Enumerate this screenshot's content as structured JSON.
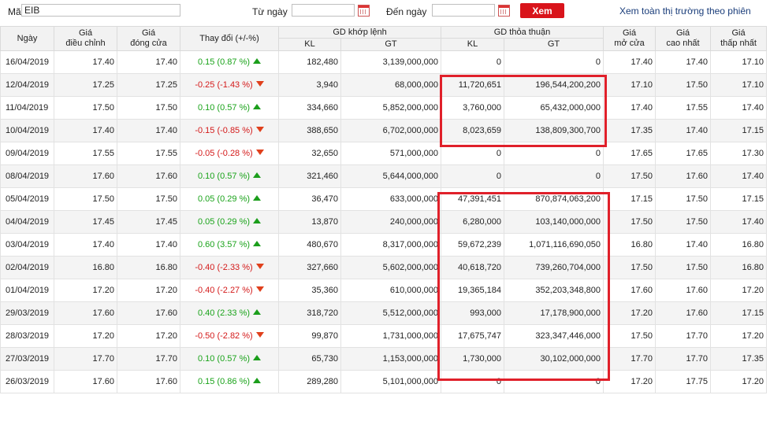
{
  "filter": {
    "ma_label": "Mã",
    "ma_value": "EIB",
    "from_label": "Từ ngày",
    "from_value": "",
    "to_label": "Đến ngày",
    "to_value": "",
    "button": "Xem",
    "market_link": "Xem toàn thị trường theo phiên",
    "calendar_icon": "calendar-icon"
  },
  "headers": {
    "date": "Ngày",
    "adjusted": "Giá\nđiều chỉnh",
    "close": "Giá\nđóng cửa",
    "change": "Thay đổi (+/-%)",
    "matched": "GD khớp lệnh",
    "negotiated": "GD thỏa thuận",
    "kl": "KL",
    "gt": "GT",
    "open": "Giá\nmở cửa",
    "high": "Giá\ncao nhất",
    "low": "Giá\nthấp nhất"
  },
  "colors": {
    "up": "#1aa31a",
    "down": "#d41a1a",
    "button": "#d9141b",
    "highlight": "#e0202a",
    "link": "#1a3d7a"
  },
  "rows": [
    {
      "date": "16/04/2019",
      "adj": "17.40",
      "close": "17.40",
      "change": "0.15 (0.87 %)",
      "dir": "up",
      "kl": "182,480",
      "gt": "3,139,000,000",
      "tt_kl": "0",
      "tt_gt": "0",
      "open": "17.40",
      "high": "17.40",
      "low": "17.10"
    },
    {
      "date": "12/04/2019",
      "adj": "17.25",
      "close": "17.25",
      "change": "-0.25 (-1.43 %)",
      "dir": "down",
      "kl": "3,940",
      "gt": "68,000,000",
      "tt_kl": "11,720,651",
      "tt_gt": "196,544,200,200",
      "open": "17.10",
      "high": "17.50",
      "low": "17.10"
    },
    {
      "date": "11/04/2019",
      "adj": "17.50",
      "close": "17.50",
      "change": "0.10 (0.57 %)",
      "dir": "up",
      "kl": "334,660",
      "gt": "5,852,000,000",
      "tt_kl": "3,760,000",
      "tt_gt": "65,432,000,000",
      "open": "17.40",
      "high": "17.55",
      "low": "17.40"
    },
    {
      "date": "10/04/2019",
      "adj": "17.40",
      "close": "17.40",
      "change": "-0.15 (-0.85 %)",
      "dir": "down",
      "kl": "388,650",
      "gt": "6,702,000,000",
      "tt_kl": "8,023,659",
      "tt_gt": "138,809,300,700",
      "open": "17.35",
      "high": "17.40",
      "low": "17.15"
    },
    {
      "date": "09/04/2019",
      "adj": "17.55",
      "close": "17.55",
      "change": "-0.05 (-0.28 %)",
      "dir": "down",
      "kl": "32,650",
      "gt": "571,000,000",
      "tt_kl": "0",
      "tt_gt": "0",
      "open": "17.65",
      "high": "17.65",
      "low": "17.30"
    },
    {
      "date": "08/04/2019",
      "adj": "17.60",
      "close": "17.60",
      "change": "0.10 (0.57 %)",
      "dir": "up",
      "kl": "321,460",
      "gt": "5,644,000,000",
      "tt_kl": "0",
      "tt_gt": "0",
      "open": "17.50",
      "high": "17.60",
      "low": "17.40"
    },
    {
      "date": "05/04/2019",
      "adj": "17.50",
      "close": "17.50",
      "change": "0.05 (0.29 %)",
      "dir": "up",
      "kl": "36,470",
      "gt": "633,000,000",
      "tt_kl": "47,391,451",
      "tt_gt": "870,874,063,200",
      "open": "17.15",
      "high": "17.50",
      "low": "17.15"
    },
    {
      "date": "04/04/2019",
      "adj": "17.45",
      "close": "17.45",
      "change": "0.05 (0.29 %)",
      "dir": "up",
      "kl": "13,870",
      "gt": "240,000,000",
      "tt_kl": "6,280,000",
      "tt_gt": "103,140,000,000",
      "open": "17.50",
      "high": "17.50",
      "low": "17.40"
    },
    {
      "date": "03/04/2019",
      "adj": "17.40",
      "close": "17.40",
      "change": "0.60 (3.57 %)",
      "dir": "up",
      "kl": "480,670",
      "gt": "8,317,000,000",
      "tt_kl": "59,672,239",
      "tt_gt": "1,071,116,690,050",
      "open": "16.80",
      "high": "17.40",
      "low": "16.80"
    },
    {
      "date": "02/04/2019",
      "adj": "16.80",
      "close": "16.80",
      "change": "-0.40 (-2.33 %)",
      "dir": "down",
      "kl": "327,660",
      "gt": "5,602,000,000",
      "tt_kl": "40,618,720",
      "tt_gt": "739,260,704,000",
      "open": "17.50",
      "high": "17.50",
      "low": "16.80"
    },
    {
      "date": "01/04/2019",
      "adj": "17.20",
      "close": "17.20",
      "change": "-0.40 (-2.27 %)",
      "dir": "down",
      "kl": "35,360",
      "gt": "610,000,000",
      "tt_kl": "19,365,184",
      "tt_gt": "352,203,348,800",
      "open": "17.60",
      "high": "17.60",
      "low": "17.20"
    },
    {
      "date": "29/03/2019",
      "adj": "17.60",
      "close": "17.60",
      "change": "0.40 (2.33 %)",
      "dir": "up",
      "kl": "318,720",
      "gt": "5,512,000,000",
      "tt_kl": "993,000",
      "tt_gt": "17,178,900,000",
      "open": "17.20",
      "high": "17.60",
      "low": "17.15"
    },
    {
      "date": "28/03/2019",
      "adj": "17.20",
      "close": "17.20",
      "change": "-0.50 (-2.82 %)",
      "dir": "down",
      "kl": "99,870",
      "gt": "1,731,000,000",
      "tt_kl": "17,675,747",
      "tt_gt": "323,347,446,000",
      "open": "17.50",
      "high": "17.70",
      "low": "17.20"
    },
    {
      "date": "27/03/2019",
      "adj": "17.70",
      "close": "17.70",
      "change": "0.10 (0.57 %)",
      "dir": "up",
      "kl": "65,730",
      "gt": "1,153,000,000",
      "tt_kl": "1,730,000",
      "tt_gt": "30,102,000,000",
      "open": "17.70",
      "high": "17.70",
      "low": "17.35"
    },
    {
      "date": "26/03/2019",
      "adj": "17.60",
      "close": "17.60",
      "change": "0.15 (0.86 %)",
      "dir": "up",
      "kl": "289,280",
      "gt": "5,101,000,000",
      "tt_kl": "0",
      "tt_gt": "0",
      "open": "17.20",
      "high": "17.75",
      "low": "17.20"
    }
  ]
}
